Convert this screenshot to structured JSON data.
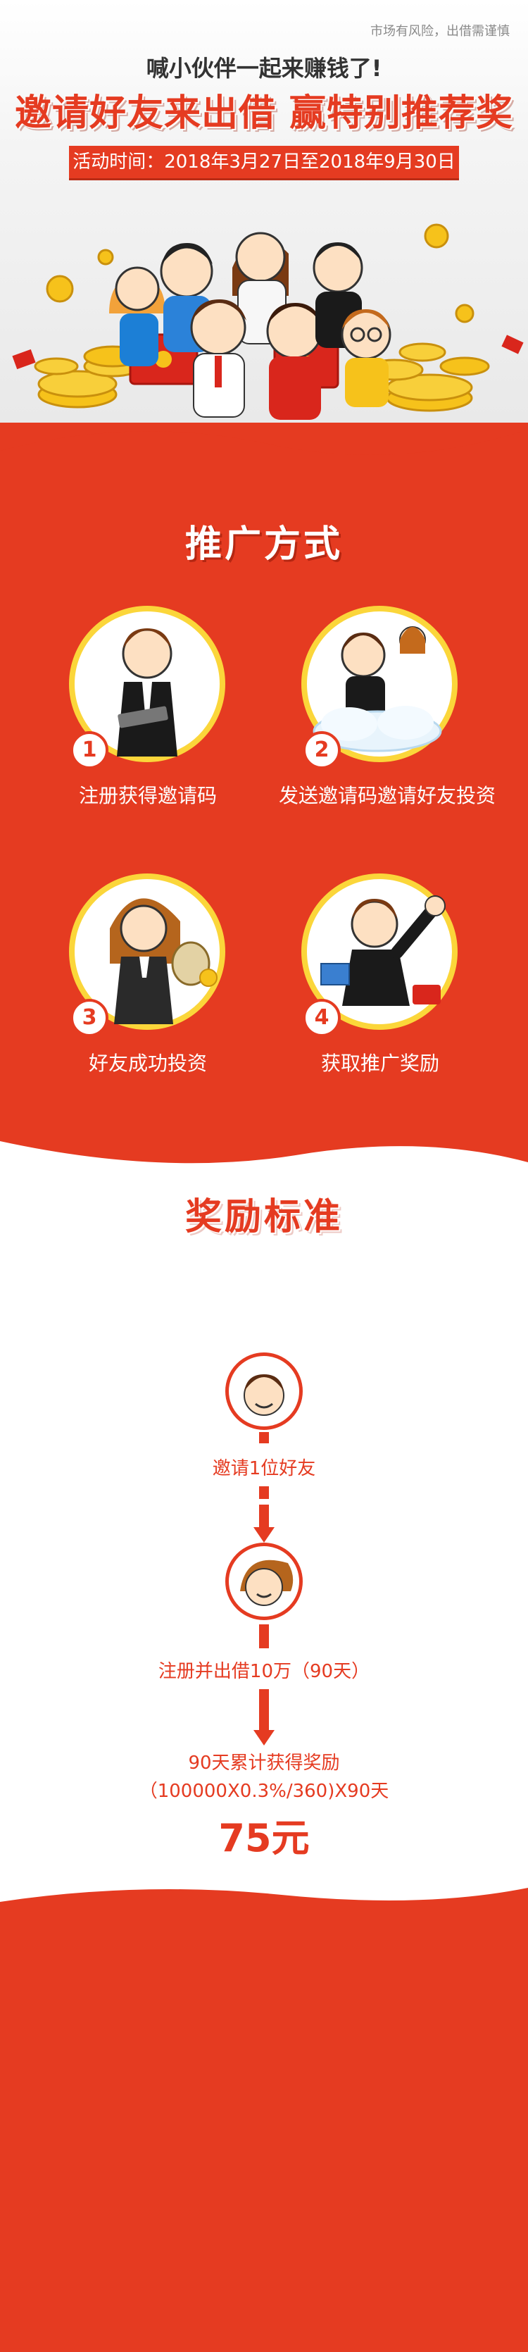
{
  "header": {
    "risk_notice": "市场有风险，出借需谨慎",
    "subtitle": "喊小伙伴一起来赚钱了!",
    "title": "邀请好友来出借 赢特别推荐奖",
    "date_range": "活动时间：2018年3月27日至2018年9月30日"
  },
  "promotion": {
    "title": "推广方式",
    "steps": [
      {
        "number": "1",
        "label": "注册获得邀请码"
      },
      {
        "number": "2",
        "label": "发送邀请码邀请好友投资"
      },
      {
        "number": "3",
        "label": "好友成功投资"
      },
      {
        "number": "4",
        "label": "获取推广奖励"
      }
    ]
  },
  "reward": {
    "title": "奖励标准",
    "step1": "邀请1位好友",
    "step2": "注册并出借10万（90天）",
    "result_line1": "90天累计获得奖励",
    "result_line2": "（100000X0.3%/360)X90天",
    "result_amount": "75元"
  },
  "colors": {
    "brand_red": "#e53b21",
    "accent_yellow": "#fbd63a",
    "coin_gold": "#f6c21b"
  }
}
